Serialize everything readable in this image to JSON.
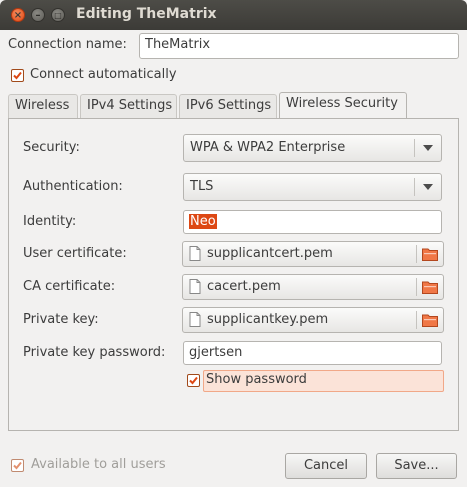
{
  "window": {
    "title": "Editing TheMatrix",
    "close_glyph": "×",
    "min_glyph": "–",
    "max_glyph": "□"
  },
  "connection": {
    "name_label": "Connection name:",
    "name_value": "TheMatrix",
    "connect_auto_label": "Connect automatically",
    "connect_auto_checked": true
  },
  "tabs": [
    {
      "label": "Wireless"
    },
    {
      "label": "IPv4 Settings"
    },
    {
      "label": "IPv6 Settings"
    },
    {
      "label": "Wireless Security",
      "active": true
    }
  ],
  "security": {
    "security_label": "Security:",
    "security_value": "WPA & WPA2 Enterprise",
    "auth_label": "Authentication:",
    "auth_value": "TLS",
    "identity_label": "Identity:",
    "identity_value": "Neo",
    "user_cert_label": "User certificate:",
    "user_cert_value": "supplicantcert.pem",
    "ca_cert_label": "CA certificate:",
    "ca_cert_value": "cacert.pem",
    "private_key_label": "Private key:",
    "private_key_value": "supplicantkey.pem",
    "pk_password_label": "Private key password:",
    "pk_password_value": "gjertsen",
    "show_password_label": "Show password",
    "show_password_checked": true
  },
  "footer": {
    "available_label": "Available to all users",
    "available_checked": true,
    "cancel_label": "Cancel",
    "save_label": "Save..."
  },
  "colors": {
    "accent": "#dd4814",
    "highlight_bg": "#fbe3d8",
    "titlebar": "#3c3b37"
  }
}
